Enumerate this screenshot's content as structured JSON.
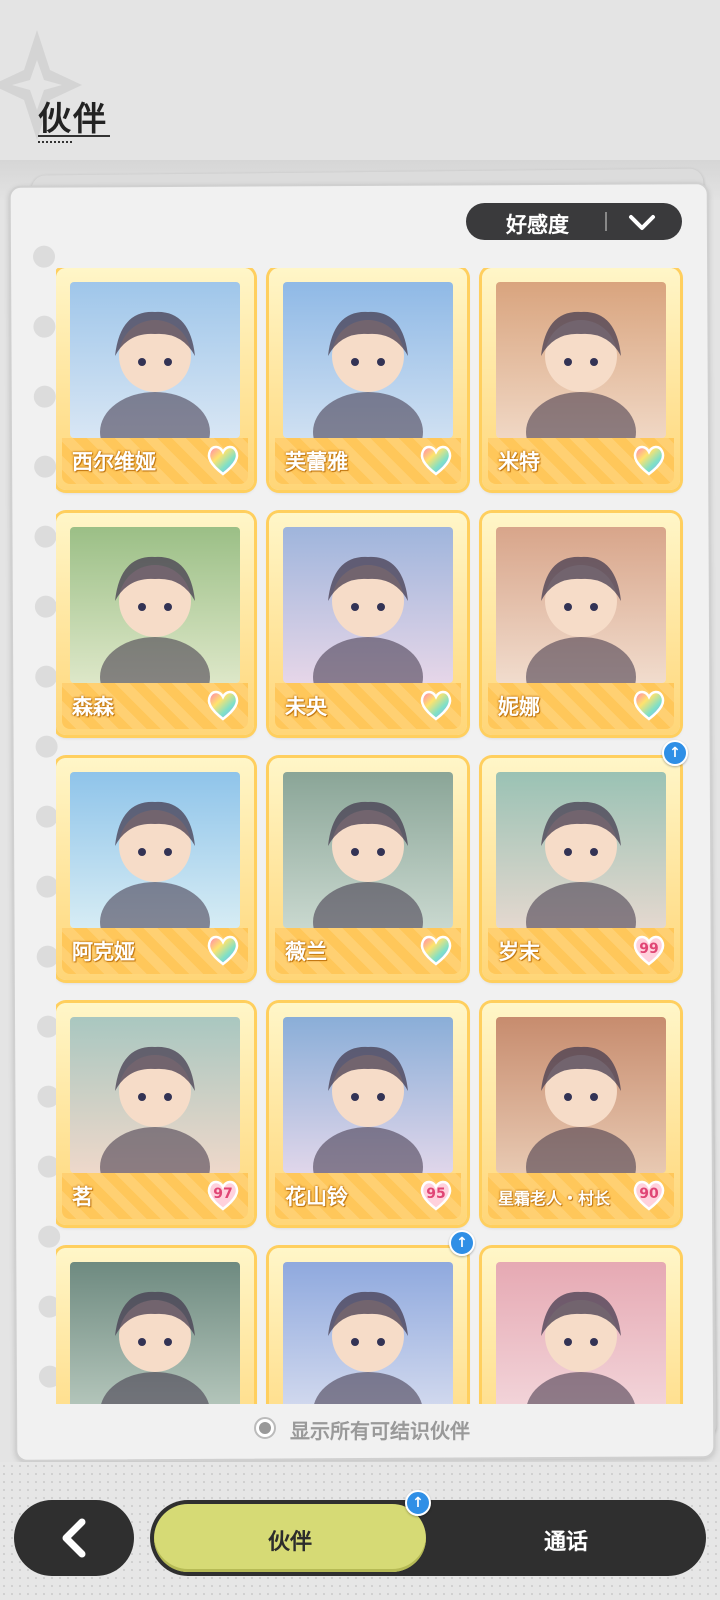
{
  "header": {
    "title": "伙伴"
  },
  "sort": {
    "label": "好感度"
  },
  "partners": [
    {
      "name": "西尔维娅",
      "affinity": "max"
    },
    {
      "name": "芙蕾雅",
      "affinity": "max"
    },
    {
      "name": "米特",
      "affinity": "max"
    },
    {
      "name": "森森",
      "affinity": "max"
    },
    {
      "name": "未央",
      "affinity": "max"
    },
    {
      "name": "妮娜",
      "affinity": "max"
    },
    {
      "name": "阿克娅",
      "affinity": "max"
    },
    {
      "name": "薇兰",
      "affinity": "max"
    },
    {
      "name": "岁末",
      "affinity": "99",
      "upgrade": true
    },
    {
      "name": "茗",
      "affinity": "97"
    },
    {
      "name": "花山铃",
      "affinity": "95"
    },
    {
      "name": "星霜老人・村长",
      "affinity": "90"
    },
    {
      "name": "",
      "affinity": ""
    },
    {
      "name": "",
      "affinity": "",
      "upgrade": true
    },
    {
      "name": "",
      "affinity": ""
    }
  ],
  "footer": {
    "show_all_label": "显示所有可结识伙伴"
  },
  "nav": {
    "back_icon": "chevron-left-icon",
    "tab_partner": "伙伴",
    "tab_call": "通话"
  },
  "colors": {
    "tile_gold": "#ffcf5e",
    "tab_active": "#d6da75",
    "upgrade_blue": "#2f8fe6",
    "heart_pink": "#e04575"
  }
}
